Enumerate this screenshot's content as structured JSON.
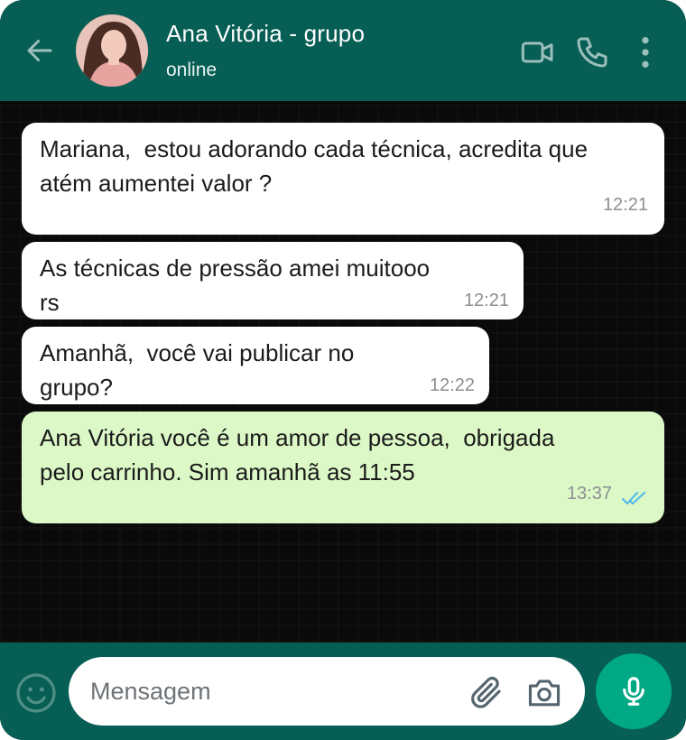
{
  "header": {
    "title": "Ana Vitória - grupo",
    "status": "online",
    "icons": {
      "back": "arrow-left-icon",
      "video": "video-camera-icon",
      "call": "phone-icon",
      "menu": "more-vertical-icon"
    }
  },
  "messages": [
    {
      "direction": "in",
      "text": "Mariana,  estou adorando cada técnica, acredita que\natém aumentei valor ?",
      "time": "12:21"
    },
    {
      "direction": "in",
      "text": "As técnicas de pressão amei muitooo\nrs",
      "time": "12:21"
    },
    {
      "direction": "in",
      "text": "Amanhã,  você vai publicar no\ngrupo?",
      "time": "12:22"
    },
    {
      "direction": "out",
      "text": "Ana Vitória você é um amor de pessoa,  obrigada\npelo carrinho. Sim amanhã as 11:55",
      "time": "13:37",
      "read_receipt": "double-check-read"
    }
  ],
  "composer": {
    "placeholder": "Mensagem",
    "icons": {
      "emoji": "emoji-icon",
      "attach": "paperclip-icon",
      "camera": "camera-icon",
      "mic": "microphone-icon"
    }
  },
  "colors": {
    "header": "#075e54",
    "incoming": "#ffffff",
    "outgoing": "#dcf8c6",
    "mic": "#00a884",
    "read_ticks": "#53bdeb"
  }
}
